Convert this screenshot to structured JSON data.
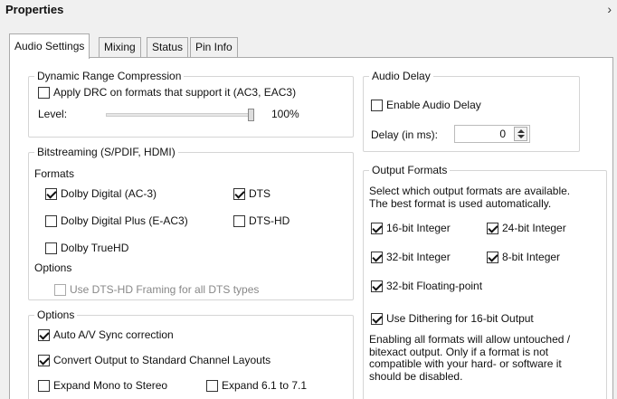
{
  "window": {
    "title": "Properties",
    "close_glyph": "›"
  },
  "tabs": [
    "Audio Settings",
    "Mixing",
    "Status",
    "Pin Info"
  ],
  "drc": {
    "legend": "Dynamic Range Compression",
    "apply_label": "Apply DRC on formats that support it (AC3, EAC3)",
    "apply_checked": false,
    "level_label": "Level:",
    "level_value": "100%",
    "level_fraction": 1.0
  },
  "bitstreaming": {
    "legend": "Bitstreaming (S/PDIF, HDMI)",
    "formats_label": "Formats",
    "formats": {
      "dolby_digital": {
        "label": "Dolby Digital (AC-3)",
        "checked": true
      },
      "dts": {
        "label": "DTS",
        "checked": true
      },
      "dolby_digital_plus": {
        "label": "Dolby Digital Plus (E-AC3)",
        "checked": false
      },
      "dts_hd": {
        "label": "DTS-HD",
        "checked": false
      },
      "dolby_truehd": {
        "label": "Dolby TrueHD",
        "checked": false
      }
    },
    "options_label": "Options",
    "dts_hd_framing": {
      "label": "Use DTS-HD Framing for all DTS types",
      "checked": false
    }
  },
  "options": {
    "legend": "Options",
    "auto_av_sync": {
      "label": "Auto A/V Sync correction",
      "checked": true
    },
    "convert_layouts": {
      "label": "Convert Output to Standard Channel Layouts",
      "checked": true
    },
    "expand_mono": {
      "label": "Expand Mono to Stereo",
      "checked": false
    },
    "expand_61": {
      "label": "Expand 6.1 to 7.1",
      "checked": false
    }
  },
  "audio_delay": {
    "legend": "Audio Delay",
    "enable": {
      "label": "Enable Audio Delay",
      "checked": false
    },
    "delay_label": "Delay (in ms):",
    "delay_value": "0"
  },
  "output_formats": {
    "legend": "Output Formats",
    "description": "Select which output formats are available.\nThe best format is used automatically.",
    "int16": {
      "label": "16-bit Integer",
      "checked": true
    },
    "int24": {
      "label": "24-bit Integer",
      "checked": true
    },
    "int32": {
      "label": "32-bit Integer",
      "checked": true
    },
    "int8": {
      "label": "8-bit Integer",
      "checked": true
    },
    "float32": {
      "label": "32-bit Floating-point",
      "checked": true
    },
    "dithering": {
      "label": "Use Dithering for 16-bit Output",
      "checked": true
    },
    "note": "Enabling all formats will allow untouched /\nbitexact output. Only if a format is not\ncompatible with your hard- or software it\nshould be disabled."
  }
}
